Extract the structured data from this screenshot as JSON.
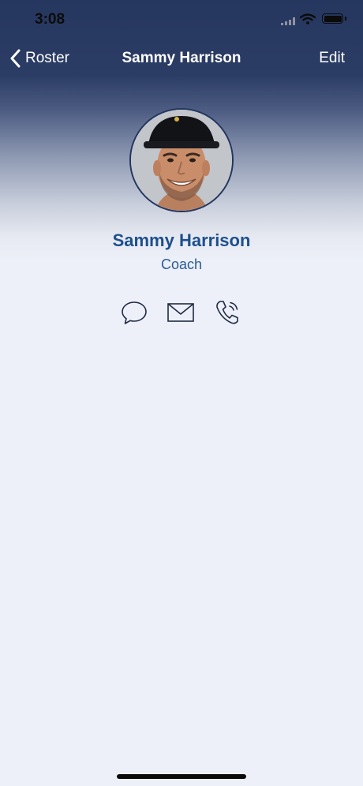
{
  "status_bar": {
    "time": "3:08",
    "icons": [
      "cellular-signal-icon",
      "wifi-icon",
      "battery-icon"
    ]
  },
  "nav": {
    "back_label": "Roster",
    "title": "Sammy Harrison",
    "edit_label": "Edit"
  },
  "profile": {
    "name": "Sammy Harrison",
    "role": "Coach"
  },
  "actions": [
    {
      "icon": "chat-bubble-icon"
    },
    {
      "icon": "envelope-icon"
    },
    {
      "icon": "phone-icon"
    }
  ],
  "colors": {
    "header_navy": "#26375f",
    "name_blue": "#1e4f8d",
    "background": "#edf0f8",
    "icon_stroke": "#1f2a44"
  }
}
